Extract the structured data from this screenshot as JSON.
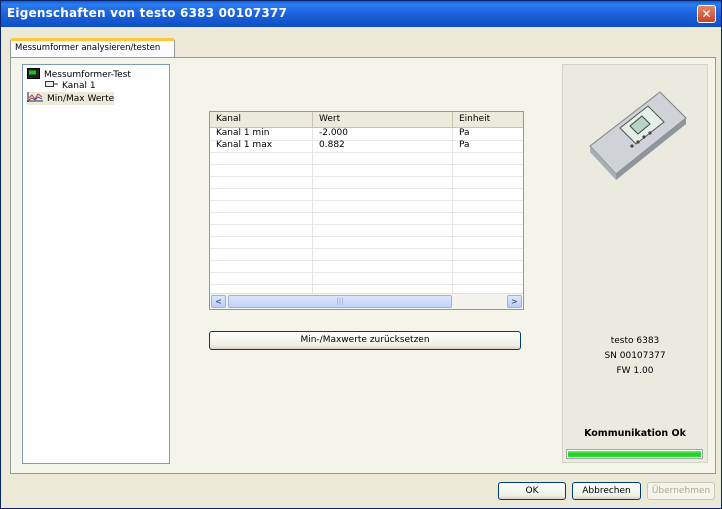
{
  "window": {
    "title": "Eigenschaften von testo 6383  00107377"
  },
  "tabs": [
    {
      "label": "Messumformer analysieren/testen"
    }
  ],
  "tree": {
    "items": [
      {
        "label": "Messumformer-Test",
        "icon": "device-icon"
      },
      {
        "label": "Kanal 1",
        "icon": "channel-icon"
      },
      {
        "label": "Min/Max Werte",
        "icon": "chart-icon"
      }
    ]
  },
  "table": {
    "columns": [
      "Kanal",
      "Wert",
      "Einheit"
    ],
    "rows": [
      [
        "Kanal 1 min",
        "-2.000",
        "Pa"
      ],
      [
        "Kanal 1 max",
        "0.882",
        "Pa"
      ]
    ]
  },
  "actions": {
    "reset_label": "Min-/Maxwerte zurücksetzen"
  },
  "device": {
    "name": "testo 6383",
    "serial": "SN 00107377",
    "firmware": "FW  1.00",
    "status": "Kommunikation Ok",
    "progress": 1.0
  },
  "footer": {
    "ok": "OK",
    "cancel": "Abbrechen",
    "apply": "Übernehmen"
  },
  "colors": {
    "titlebar": "#1a5fd9",
    "tab_highlight": "#ffc83c",
    "progress": "#1ecb1e"
  }
}
